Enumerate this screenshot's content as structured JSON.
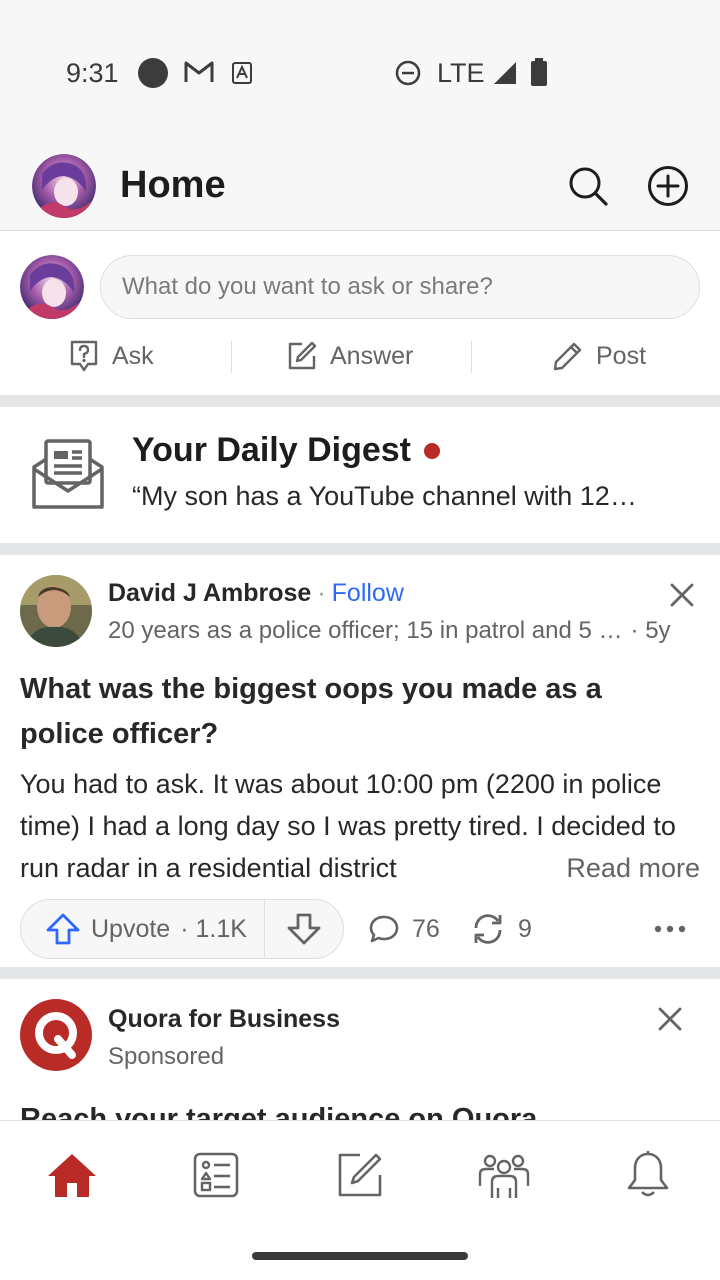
{
  "status_bar": {
    "time": "9:31",
    "network": "LTE"
  },
  "header": {
    "title": "Home"
  },
  "composer": {
    "placeholder": "What do you want to ask or share?",
    "actions": [
      {
        "label": "Ask",
        "icon": "ask-icon"
      },
      {
        "label": "Answer",
        "icon": "answer-icon"
      },
      {
        "label": "Post",
        "icon": "pencil-icon"
      }
    ]
  },
  "digest": {
    "title": "Your Daily Digest",
    "snippet": "“My son has a YouTube channel with 12…"
  },
  "answer_card": {
    "author": "David J Ambrose",
    "separator": "·",
    "follow": "Follow",
    "credential": "20 years as a police officer; 15 in patrol and 5 …",
    "age": "· 5y",
    "question": "What was the biggest oops you made as a police officer?",
    "answer": "You had to ask. It was about 10:00 pm (2200 in police time) I had a long day so I was pretty tired. I decided to run radar in a residential district",
    "read_more": "Read more",
    "upvote_label": "Upvote",
    "upvote_count": "· 1.1K",
    "comments": "76",
    "shares": "9"
  },
  "sponsored_card": {
    "name": "Quora for Business",
    "label": "Sponsored",
    "headline": "Reach your target audience on Quora"
  },
  "bottom_nav": [
    {
      "name": "home",
      "icon": "home-icon",
      "active": true
    },
    {
      "name": "following",
      "icon": "following-icon",
      "active": false
    },
    {
      "name": "answer",
      "icon": "answer-icon",
      "active": false
    },
    {
      "name": "spaces",
      "icon": "spaces-icon",
      "active": false
    },
    {
      "name": "notifications",
      "icon": "bell-icon",
      "active": false
    }
  ],
  "colors": {
    "brand": "#b92b27",
    "link": "#2e69ff",
    "text": "#282829",
    "muted": "#636466"
  }
}
